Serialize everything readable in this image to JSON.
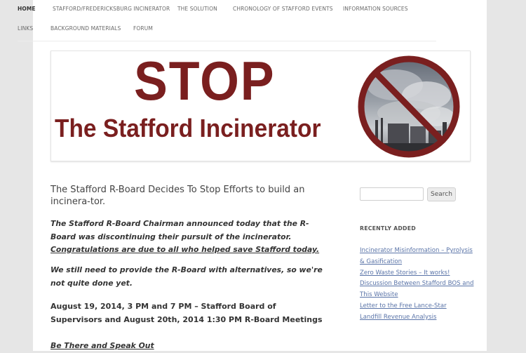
{
  "nav": {
    "row1": [
      "HOME",
      "STAFFORD/FREDERICKSBURG INCINERATOR",
      "THE SOLUTION",
      "CHRONOLOGY OF STAFFORD EVENTS",
      "INFORMATION SOURCES"
    ],
    "row2": [
      "LINKS",
      "BACKGROUND MATERIALS",
      "FORUM"
    ]
  },
  "banner": {
    "stop": "STOP",
    "subtitle": "The Stafford Incinerator"
  },
  "post": {
    "title": "The Stafford R-Board Decides To Stop Efforts to build an incinera-tor.",
    "p1_text": "The Stafford R-Board Chairman announced today that the R-Board was discontinuing their pursuit of the incinerator. ",
    "p1_link": "Congratulations are due to all who helped save Stafford today.",
    "p2": "We still need to provide the R-Board with alternatives, so we're not quite done yet.",
    "p3": "August 19, 2014, 3 PM and 7 PM – Stafford Board of Supervisors and August 20th, 2014 1:30 PM R-Board Meetings",
    "p4": "Be There and Speak Out"
  },
  "sidebar": {
    "search_button": "Search",
    "search_value": "",
    "recent_title": "RECENTLY ADDED",
    "recent_items": [
      "Incinerator Misinformation – Pyrolysis & Gasification",
      "Zero Waste Stories – It works!",
      "Discussion Between Stafford BOS and This Website",
      "Letter to the Free Lance-Star",
      "Landfill Revenue Analysis"
    ]
  },
  "colors": {
    "banner_red": "#7a1f1f",
    "link_blue": "#5a74a8"
  }
}
